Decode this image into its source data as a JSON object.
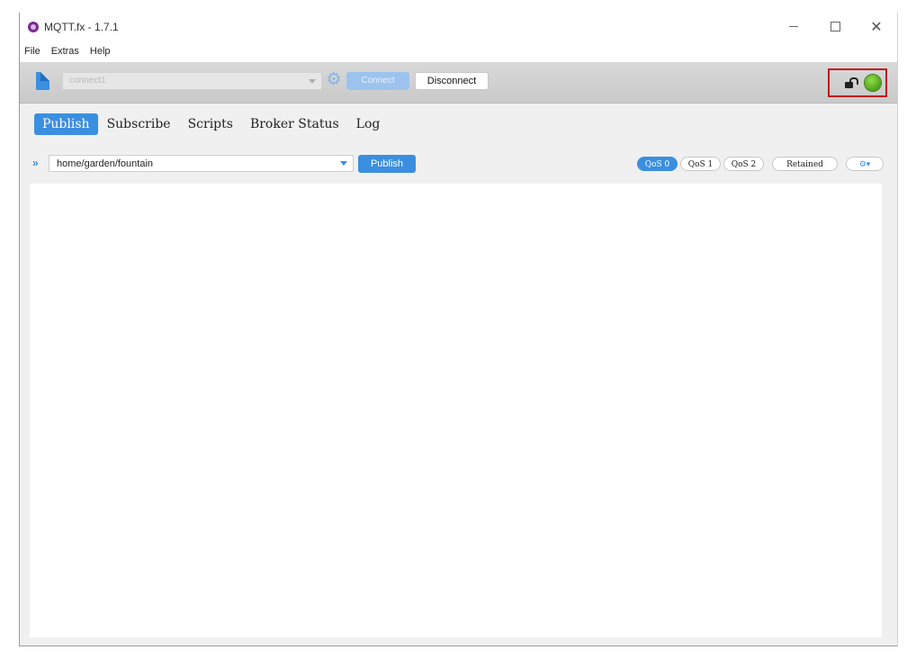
{
  "window": {
    "title": "MQTT.fx - 1.7.1",
    "controls": {
      "minimize": "",
      "maximize": "",
      "close": "✕"
    }
  },
  "menu": {
    "items": [
      "File",
      "Extras",
      "Help"
    ]
  },
  "connection": {
    "profile": "connect1",
    "connect_label": "Connect",
    "disconnect_label": "Disconnect",
    "status": {
      "lock": "unlocked",
      "indicator_color": "#5cb82a",
      "highlight_color": "#c0141a"
    }
  },
  "tabs": {
    "items": [
      "Publish",
      "Subscribe",
      "Scripts",
      "Broker Status",
      "Log"
    ],
    "active": "Publish"
  },
  "publish": {
    "topic": "home/garden/fountain",
    "publish_label": "Publish",
    "qos": [
      "QoS 0",
      "QoS 1",
      "QoS 2"
    ],
    "qos_selected": "QoS 0",
    "retained_label": "Retained",
    "payload": ""
  },
  "icons": {
    "new_profile": "document-icon",
    "settings": "gear-icon",
    "expand": "double-chevron-icon",
    "lock": "unlocked-padlock-icon",
    "options": "gear-dropdown-icon"
  },
  "colors": {
    "accent": "#3b8fe0"
  }
}
